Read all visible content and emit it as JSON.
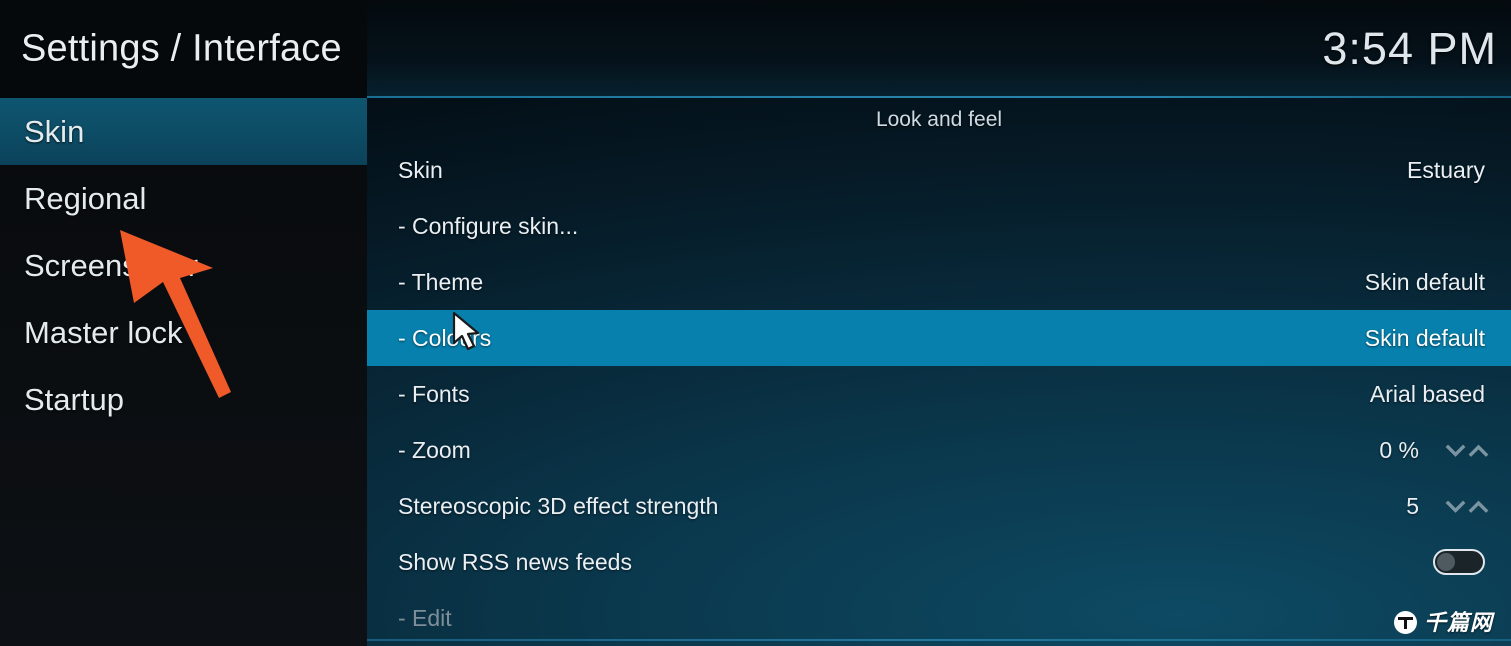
{
  "header": {
    "title": "Settings / Interface",
    "clock": "3:54 PM"
  },
  "sidebar": {
    "items": [
      {
        "label": "Skin",
        "selected": true
      },
      {
        "label": "Regional",
        "selected": false
      },
      {
        "label": "Screensaver",
        "selected": false
      },
      {
        "label": "Master lock",
        "selected": false
      },
      {
        "label": "Startup",
        "selected": false
      }
    ]
  },
  "main": {
    "section_title": "Look and feel",
    "rows": [
      {
        "label": "Skin",
        "value": "Estuary",
        "control": "none",
        "selected": false,
        "disabled": false
      },
      {
        "label": "- Configure skin...",
        "value": "",
        "control": "none",
        "selected": false,
        "disabled": false
      },
      {
        "label": "- Theme",
        "value": "Skin default",
        "control": "none",
        "selected": false,
        "disabled": false
      },
      {
        "label": "- Colours",
        "value": "Skin default",
        "control": "none",
        "selected": true,
        "disabled": false
      },
      {
        "label": "- Fonts",
        "value": "Arial based",
        "control": "none",
        "selected": false,
        "disabled": false
      },
      {
        "label": "- Zoom",
        "value": "0 %",
        "control": "spinner",
        "selected": false,
        "disabled": false
      },
      {
        "label": "Stereoscopic 3D effect strength",
        "value": "5",
        "control": "spinner",
        "selected": false,
        "disabled": false
      },
      {
        "label": "Show RSS news feeds",
        "value": "",
        "control": "toggle-off",
        "selected": false,
        "disabled": false
      },
      {
        "label": "- Edit",
        "value": "",
        "control": "none",
        "selected": false,
        "disabled": true
      }
    ]
  },
  "annotation": {
    "arrow_color": "#f05a28",
    "arrow_name": "pointer-arrow-annotation"
  },
  "watermark": {
    "text": "千篇网"
  },
  "colors": {
    "selected_row": "#0780ad",
    "sidebar_selected": "#0d4d66",
    "accent_rule": "#2b93bd"
  }
}
